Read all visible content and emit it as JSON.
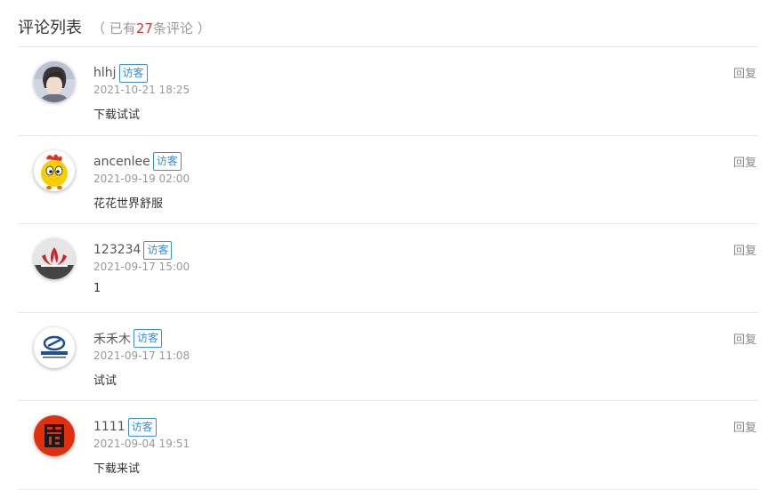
{
  "header": {
    "title": "评论列表",
    "count_prefix": "（ 已有",
    "count_number": "27",
    "count_suffix": "条评论 ）"
  },
  "colors": {
    "accent_red": "#e0312a",
    "badge_blue": "#3a8ee6"
  },
  "comments": [
    {
      "name": "hlhj",
      "badge": "访客",
      "date": "2021-10-21 18:25",
      "text": "下载试试",
      "reply": "回复",
      "avatar_icon": "person-photo-avatar"
    },
    {
      "name": "ancenlee",
      "badge": "访客",
      "date": "2021-09-19 02:00",
      "text": "花花世界舒服",
      "reply": "回复",
      "avatar_icon": "cartoon-chick-avatar"
    },
    {
      "name": "123234",
      "badge": "访客",
      "date": "2021-09-17 15:00",
      "text": "1",
      "reply": "回复",
      "avatar_icon": "red-emblem-avatar"
    },
    {
      "name": "禾禾木",
      "badge": "访客",
      "date": "2021-09-17 11:08",
      "text": "试试",
      "reply": "回复",
      "avatar_icon": "site-logo-avatar"
    },
    {
      "name": "1111",
      "badge": "访客",
      "date": "2021-09-04 19:51",
      "text": "下载来试",
      "reply": "回复",
      "avatar_icon": "red-circle-logo-avatar"
    }
  ]
}
